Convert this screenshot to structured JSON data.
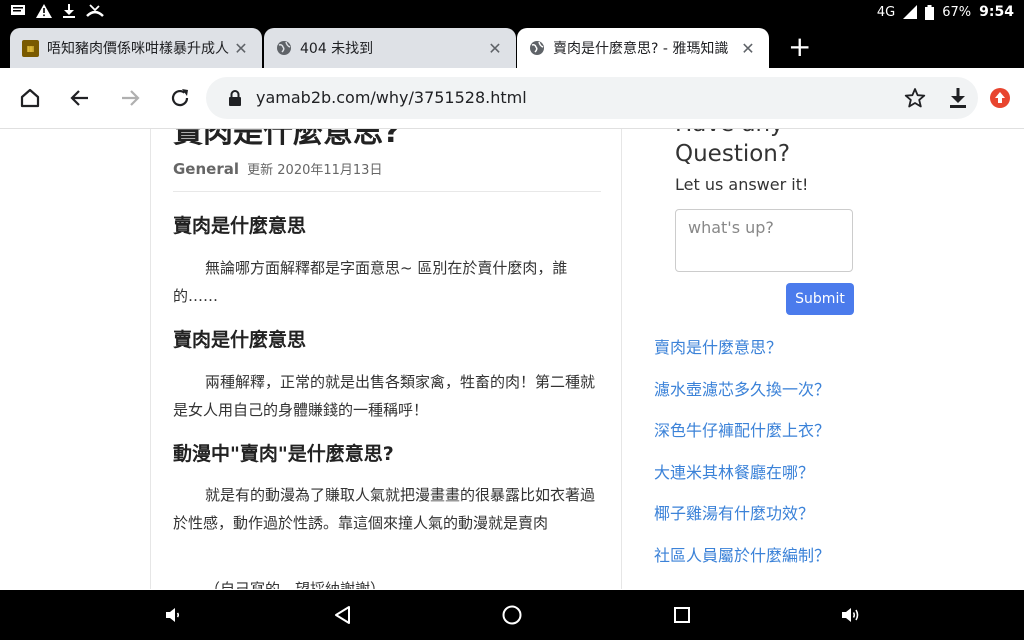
{
  "status_bar": {
    "left_icons": [
      "message-icon",
      "warning-icon",
      "download-icon",
      "missed-call-icon"
    ],
    "network": "4G",
    "battery": "67%",
    "time": "9:54"
  },
  "tabs": [
    {
      "title": "唔知豬肉價係咪咁樣暴升成人",
      "favicon": "food-logo-icon",
      "active": false
    },
    {
      "title": "404 未找到",
      "favicon": "globe-icon",
      "active": false
    },
    {
      "title": "賣肉是什麼意思? - 雅瑪知識",
      "favicon": "globe-icon",
      "active": true
    }
  ],
  "toolbar": {
    "url": "yamab2b.com/why/3751528.html"
  },
  "article": {
    "title": "賣肉是什麼意思?",
    "category": "General",
    "updated": "更新 2020年11月13日",
    "sections": [
      {
        "heading": "賣肉是什麼意思",
        "text": "無論哪方面解釋都是字面意思~ 區別在於賣什麼肉，誰的……"
      },
      {
        "heading": "賣肉是什麼意思",
        "text": "兩種解釋，正常的就是出售各類家禽，牲畜的肉！第二種就是女人用自己的身體賺錢的一種稱呼！"
      },
      {
        "heading": "動漫中\"賣肉\"是什麼意思?",
        "text": "就是有的動漫為了賺取人氣就把漫畫畫的很暴露比如衣著過於性感，動作過於性誘。靠這個來撞人氣的動漫就是賣肉"
      },
      {
        "heading": "",
        "text": "（自己寫的，望採納謝謝）"
      }
    ]
  },
  "sidebar": {
    "question_title": "Have any Question?",
    "question_sub": "Let us answer it!",
    "input_placeholder": "what's up?",
    "submit_label": "Submit",
    "related": [
      "賣肉是什麼意思？",
      "濾水壺濾芯多久換一次？",
      "深色牛仔褲配什麼上衣？",
      "大連米其林餐廳在哪？",
      "椰子雞湯有什麼功效？",
      "社區人員屬於什麼編制？"
    ]
  },
  "colors": {
    "accent": "#4b7bec",
    "link": "#3b82d8",
    "tab_inactive": "#dee1e6"
  }
}
